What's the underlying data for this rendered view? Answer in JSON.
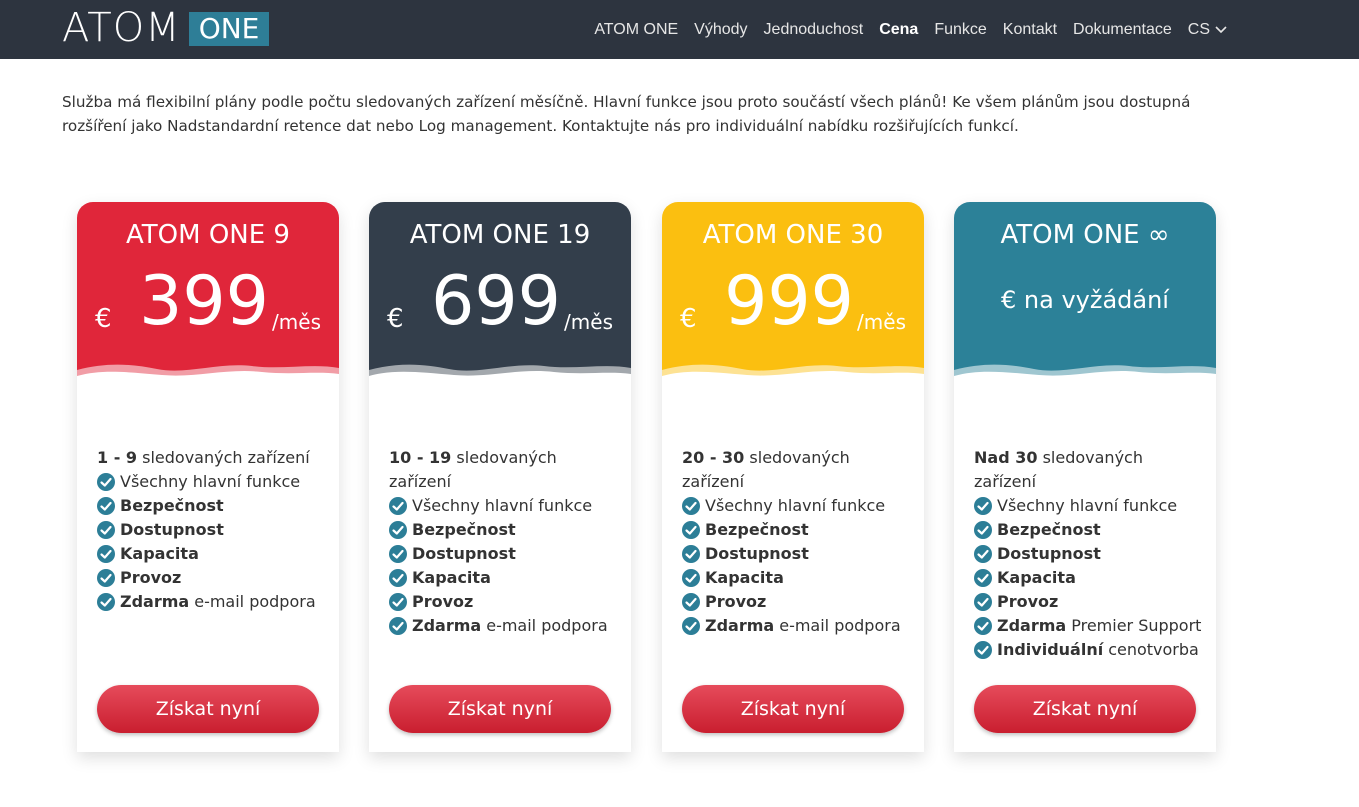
{
  "header": {
    "logo_atom": "ATOM",
    "logo_one": "ONE",
    "nav": [
      "ATOM ONE",
      "Výhody",
      "Jednoduchost",
      "Cena",
      "Funkce",
      "Kontakt",
      "Dokumentace"
    ],
    "active_nav": "Cena",
    "language": "CS"
  },
  "intro": "Služba má flexibilní plány podle počtu sledovaných zařízení měsíčně. Hlavní funkce jsou proto součástí všech plánů! Ke všem plánům jsou dostupná rozšíření jako Nadstandardní retence dat nebo Log management. Kontaktujte nás pro individuální nabídku rozšiřujících funkcí.",
  "colors": {
    "red": "#e0263a",
    "dark": "#333e4b",
    "yellow": "#fbbf10",
    "teal": "#2c8198",
    "check": "#2c7e97",
    "button": "#d62a3b"
  },
  "plans": [
    {
      "name": "ATOM ONE 9",
      "currency": "€",
      "price": "399",
      "period": "/měs",
      "devices_bold": "1 - 9",
      "devices_text": "sledovaných zařízení",
      "features": [
        {
          "bold": "",
          "text": "Všechny hlavní funkce"
        },
        {
          "bold": "Bezpečnost",
          "text": ""
        },
        {
          "bold": "Dostupnost",
          "text": ""
        },
        {
          "bold": "Kapacita",
          "text": ""
        },
        {
          "bold": "Provoz",
          "text": ""
        },
        {
          "bold": "Zdarma",
          "text": "e-mail podpora"
        }
      ],
      "cta": "Získat nyní"
    },
    {
      "name": "ATOM ONE 19",
      "currency": "€",
      "price": "699",
      "period": "/měs",
      "devices_bold": "10 - 19",
      "devices_text": "sledovaných zařízení",
      "features": [
        {
          "bold": "",
          "text": "Všechny hlavní funkce"
        },
        {
          "bold": "Bezpečnost",
          "text": ""
        },
        {
          "bold": "Dostupnost",
          "text": ""
        },
        {
          "bold": "Kapacita",
          "text": ""
        },
        {
          "bold": "Provoz",
          "text": ""
        },
        {
          "bold": "Zdarma",
          "text": "e-mail podpora"
        }
      ],
      "cta": "Získat nyní"
    },
    {
      "name": "ATOM ONE 30",
      "currency": "€",
      "price": "999",
      "period": "/měs",
      "devices_bold": "20 - 30",
      "devices_text": "sledovaných zařízení",
      "features": [
        {
          "bold": "",
          "text": "Všechny hlavní funkce"
        },
        {
          "bold": "Bezpečnost",
          "text": ""
        },
        {
          "bold": "Dostupnost",
          "text": ""
        },
        {
          "bold": "Kapacita",
          "text": ""
        },
        {
          "bold": "Provoz",
          "text": ""
        },
        {
          "bold": "Zdarma",
          "text": "e-mail podpora"
        }
      ],
      "cta": "Získat nyní"
    },
    {
      "name": "ATOM ONE ∞",
      "on_request": "€ na vyžádání",
      "devices_bold": "Nad 30",
      "devices_text": "sledovaných zařízení",
      "features": [
        {
          "bold": "",
          "text": "Všechny hlavní funkce"
        },
        {
          "bold": "Bezpečnost",
          "text": ""
        },
        {
          "bold": "Dostupnost",
          "text": ""
        },
        {
          "bold": "Kapacita",
          "text": ""
        },
        {
          "bold": "Provoz",
          "text": ""
        },
        {
          "bold": "Zdarma",
          "text": "Premier Support"
        },
        {
          "bold": "Individuální",
          "text": "cenotvorba"
        }
      ],
      "cta": "Získat nyní"
    }
  ]
}
